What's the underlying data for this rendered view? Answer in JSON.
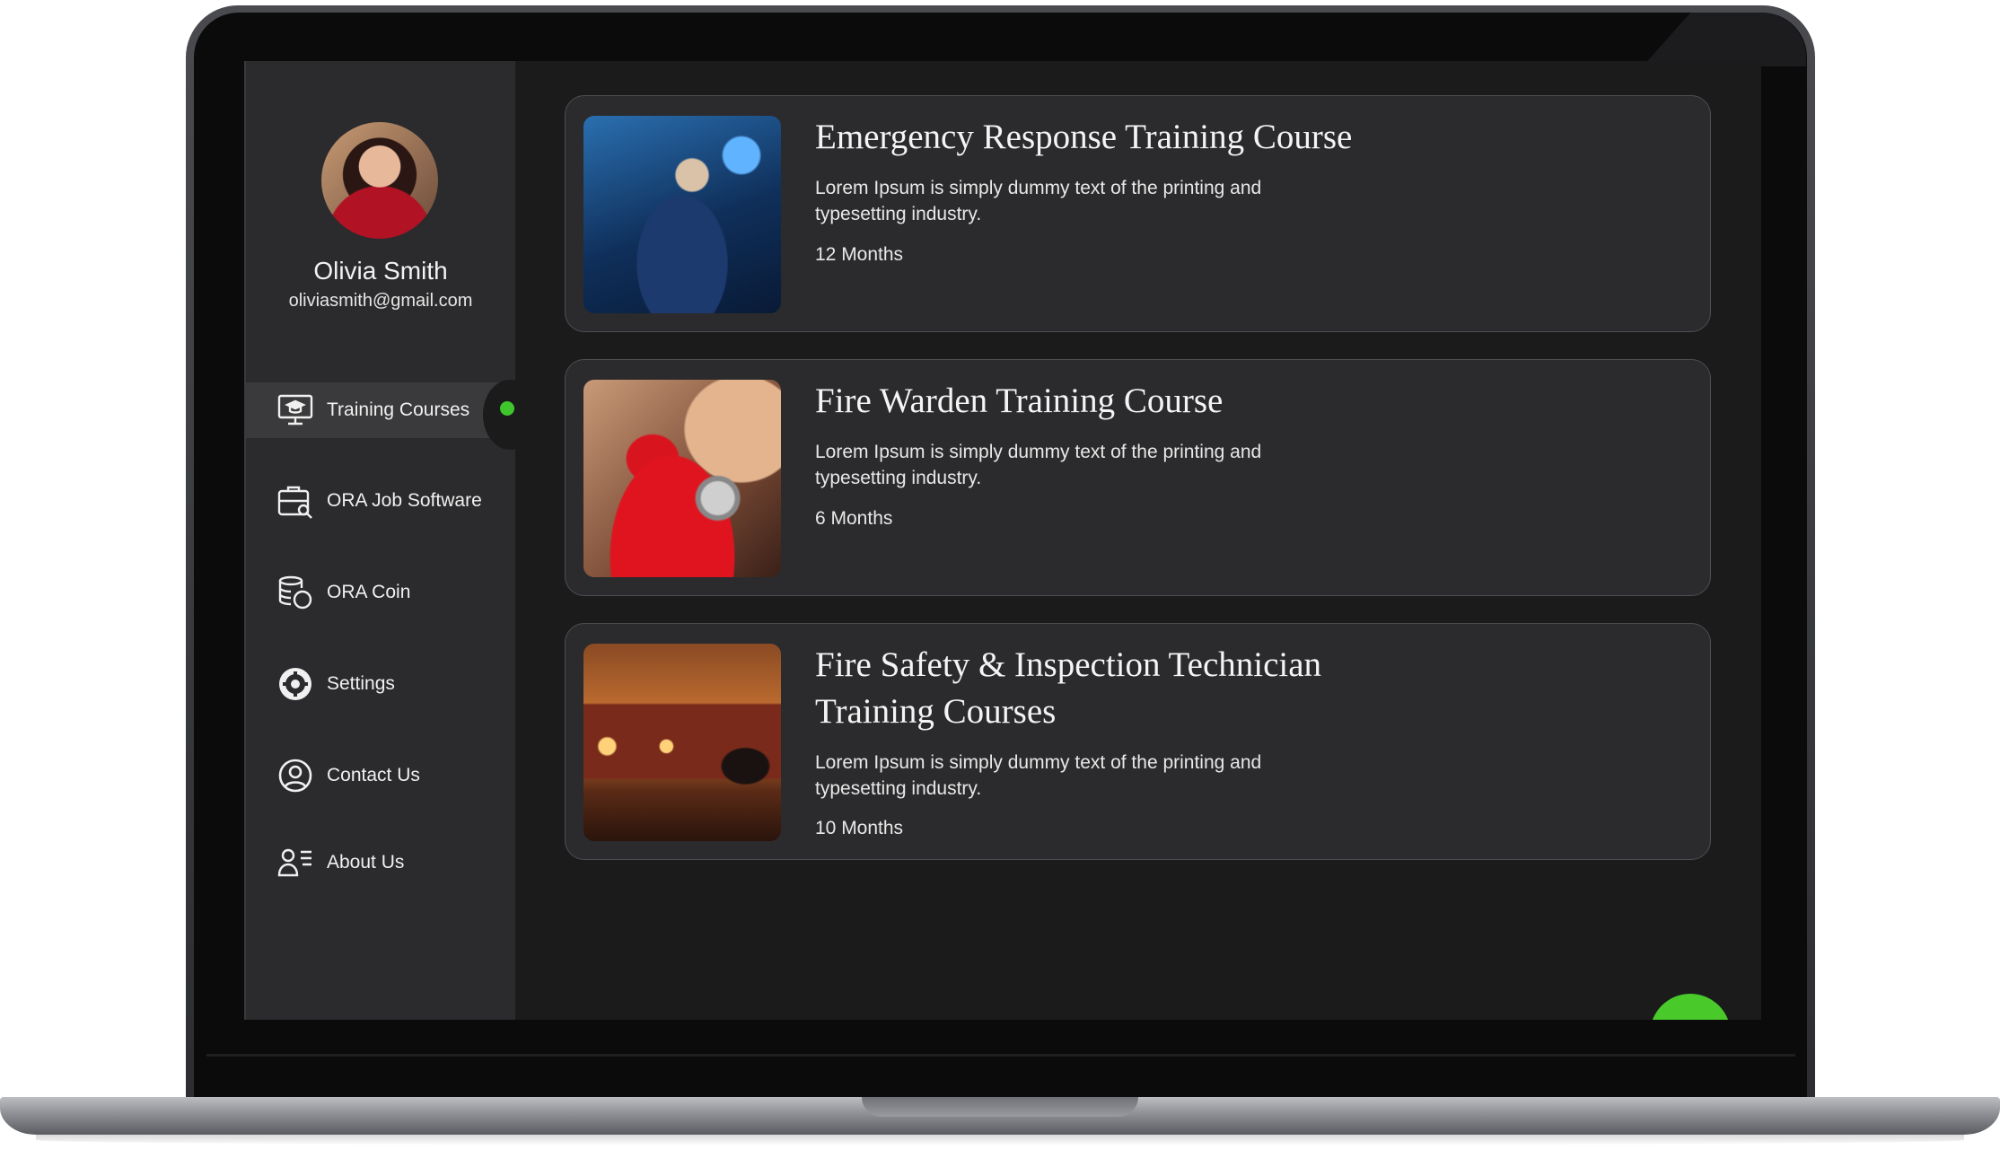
{
  "user": {
    "name": "Olivia Smith",
    "email": "oliviasmith@gmail.com"
  },
  "nav": {
    "items": [
      {
        "label": "Training Courses",
        "icon": "training-courses-icon",
        "active": true
      },
      {
        "label": "ORA Job Software",
        "icon": "job-software-icon",
        "active": false
      },
      {
        "label": "ORA Coin",
        "icon": "coin-icon",
        "active": false
      },
      {
        "label": "Settings",
        "icon": "settings-icon",
        "active": false
      },
      {
        "label": "Contact Us",
        "icon": "contact-icon",
        "active": false
      },
      {
        "label": "About Us",
        "icon": "about-icon",
        "active": false
      }
    ]
  },
  "courses": [
    {
      "title": "Emergency Response Training Course",
      "description": "Lorem Ipsum is simply dummy text of the printing and typesetting industry.",
      "duration": "12 Months",
      "image": "emergency-response-image"
    },
    {
      "title": "Fire Warden Training Course",
      "description": "Lorem Ipsum is simply dummy text of the printing and typesetting industry.",
      "duration": "6 Months",
      "image": "fire-extinguisher-image"
    },
    {
      "title": "Fire Safety & Inspection Technician Training Courses",
      "description": "Lorem Ipsum is simply dummy text of the printing and typesetting industry.",
      "duration": "10 Months",
      "image": "fire-truck-image"
    }
  ],
  "colors": {
    "accent": "#3fc62c",
    "background": "#1b1b1c",
    "card": "#2b2b2d"
  }
}
